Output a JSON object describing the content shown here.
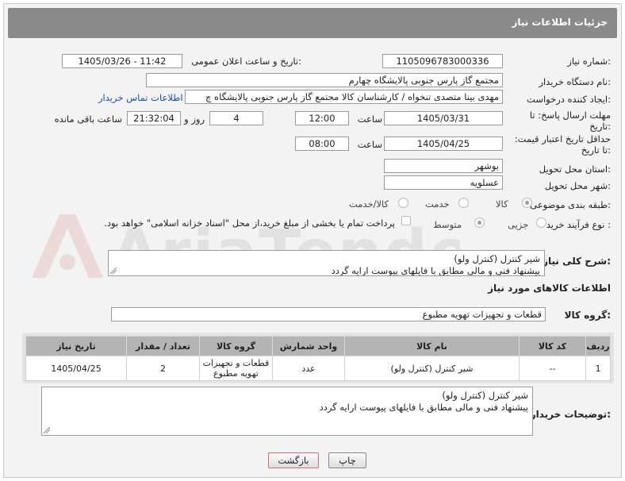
{
  "header": {
    "title": "جزئیات اطلاعات نیاز"
  },
  "fields": {
    "need_number_label": "شماره نیاز:",
    "need_number": "1105096783000336",
    "announce_label": "تاریخ و ساعت اعلان عمومی:",
    "announce_value": "1405/03/26 - 11:42",
    "buyer_org_label": "نام دستگاه خریدار:",
    "buyer_org": "مجتمع گاز پارس جنوبی  پالایشگاه چهارم",
    "creator_label": "ایجاد کننده درخواست:",
    "creator": "مهدی بینا متصدی تنخواه / کارشناسان کالا مجتمع گاز پارس جنوبی  پالایشگاه چ",
    "buyer_contact_link": "اطلاعات تماس خریدار",
    "reply_deadline_label": "مهلت ارسال پاسخ: تا تاریخ:",
    "reply_date": "1405/03/31",
    "hour_label": "ساعت",
    "reply_time": "12:00",
    "days_value": "4",
    "days_label": "روز و",
    "remaining_time": "21:32:04",
    "remaining_label": "ساعت باقی مانده",
    "price_validity_label": "حداقل تاریخ اعتبار قیمت: تا تاریخ:",
    "price_date": "1405/04/25",
    "price_hour_label": "ساعت",
    "price_time": "08:00",
    "province_label": "استان محل تحویل:",
    "province": "بوشهر",
    "city_label": "شهر محل تحویل:",
    "city": "عسلویه",
    "category_label": "طبقه بندی موضوعی:",
    "category_options": [
      "کالا",
      "خدمت",
      "کالا/خدمت"
    ],
    "purchase_type_label": "نوع فرآیند خرید :",
    "purchase_options": [
      "جزیی",
      "متوسط"
    ],
    "payment_note": "پرداخت تمام یا بخشی از مبلغ خرید،از محل \"اسناد خزانه اسلامی\" خواهد بود."
  },
  "description": {
    "label": "شرح کلی نیاز:",
    "line1": "شیر کنترل (کنترل ولو)",
    "line2": "پیشنهاد فنی و مالی مطابق با فایلهای پیوست ارایه گردد"
  },
  "goods_section": {
    "title": "اطلاعات کالاهای مورد نیاز",
    "group_label": "گروه کالا:",
    "group_value": "قطعات و تجهیزات تهویه مطبوع"
  },
  "table": {
    "headers": [
      "ردیف",
      "کد کالا",
      "نام کالا",
      "واحد شمارش",
      "گروه کالا",
      "تعداد / مقدار",
      "تاریخ نیاز"
    ],
    "rows": [
      [
        "1",
        "--",
        "شیر کنترل (کنترل ولو)",
        "عدد",
        "قطعات و تجهیزات تهویه مطبوع",
        "2",
        "1405/04/25"
      ]
    ]
  },
  "buyer_notes": {
    "label": "توضیحات خریدار:",
    "line1": "شیر کنترل (کنترل ولو)",
    "line2": "پیشنهاد فنی و مالی مطابق با فایلهای پیوست ارایه گردد"
  },
  "buttons": {
    "print": "چاپ",
    "back": "بازگشت"
  },
  "watermark": "AriaTender.net",
  "colors": {
    "header_bg": "#8a8a8a",
    "link": "#1a4fb5",
    "back_button_border": "#d07070"
  }
}
